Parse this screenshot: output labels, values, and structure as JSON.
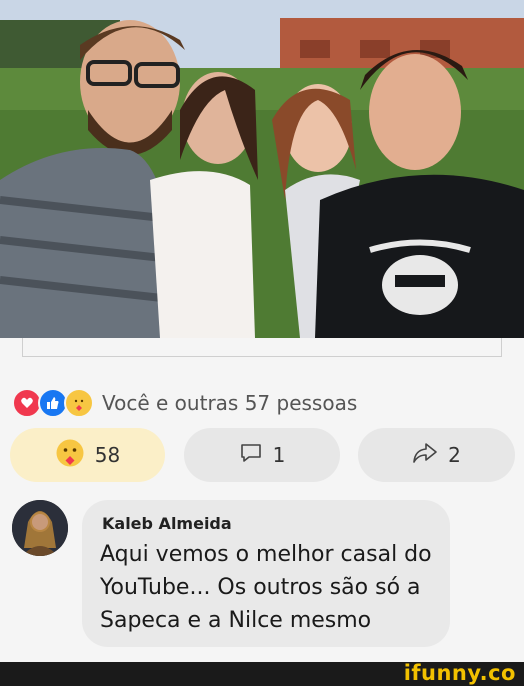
{
  "post": {
    "photo_icon": "group-selfie-photo"
  },
  "reactions": {
    "icons": [
      "love-icon",
      "like-icon",
      "care-icon"
    ],
    "summary": "Você e outras 57 pessoas"
  },
  "actions": {
    "react_count": "58",
    "comment_count": "1",
    "share_count": "2"
  },
  "comment": {
    "author": "Kaleb Almeida",
    "text": "Aqui vemos o melhor casal do YouTube... Os outros são só a Sapeca e a Nilce mesmo"
  },
  "watermark": {
    "text": "ifunny.co"
  },
  "colors": {
    "react_button_bg": "#fbefc8",
    "neutral_button_bg": "#e7e7e7",
    "watermark": "#f2c100"
  }
}
